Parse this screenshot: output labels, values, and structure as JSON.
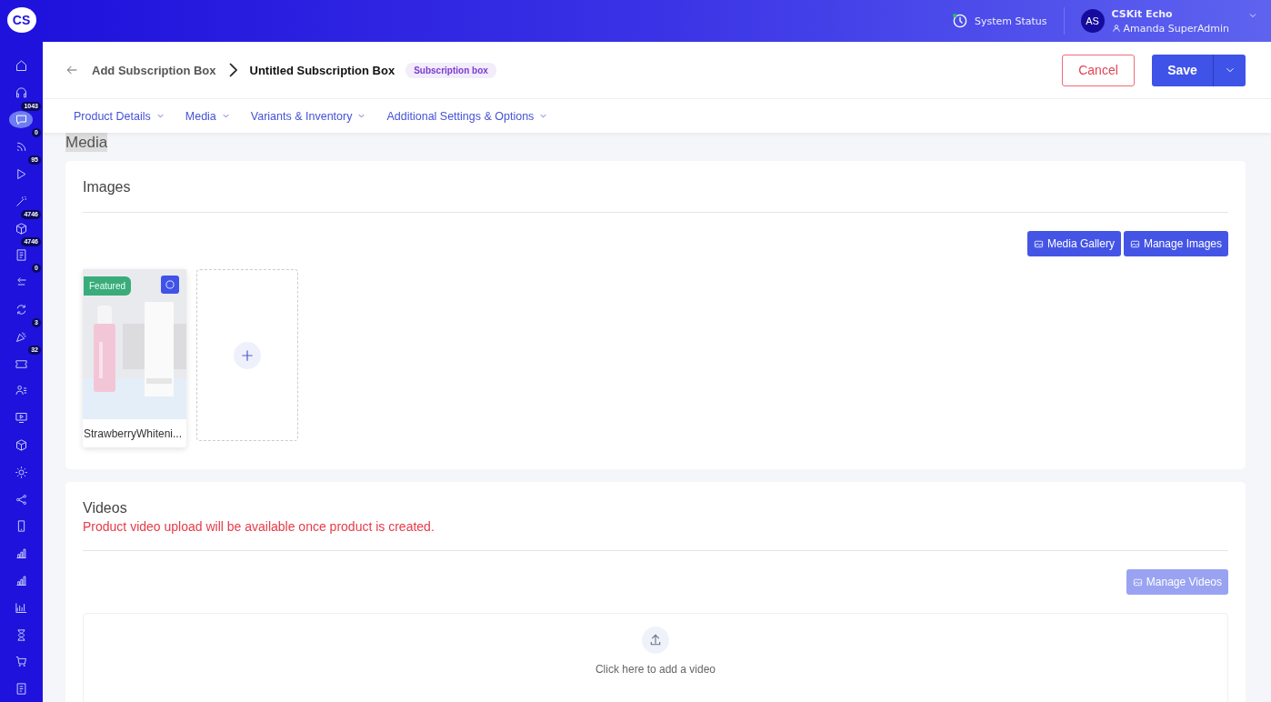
{
  "logo": "CS",
  "sidebar": {
    "items": [
      {
        "selected": false
      },
      {
        "selected": false
      },
      {
        "selected": true,
        "badge": "1043"
      },
      {
        "selected": false,
        "badge": "0"
      },
      {
        "selected": false,
        "badge": "95"
      },
      {
        "selected": false
      },
      {
        "selected": false,
        "badge": "4746"
      },
      {
        "selected": false,
        "badge": "4746"
      },
      {
        "selected": false,
        "badge": "0"
      },
      {
        "selected": false
      },
      {
        "selected": false,
        "badge": "3"
      },
      {
        "selected": false,
        "badge": "32"
      },
      {
        "selected": false
      },
      {
        "selected": false
      },
      {
        "selected": false
      },
      {
        "selected": false
      },
      {
        "selected": false
      },
      {
        "selected": false
      },
      {
        "selected": false
      },
      {
        "selected": false
      },
      {
        "selected": false
      },
      {
        "selected": false
      },
      {
        "selected": false
      },
      {
        "selected": false
      }
    ]
  },
  "topbar": {
    "system_status": "System Status",
    "user": {
      "initials": "AS",
      "org": "CSKit Echo",
      "name": "Amanda SuperAdmin"
    }
  },
  "header": {
    "breadcrumb": "Add Subscription Box",
    "title": "Untitled Subscription Box",
    "tag": "Subscription box",
    "buttons": {
      "cancel": "Cancel",
      "save": "Save"
    }
  },
  "tabs": [
    {
      "label": "Product Details"
    },
    {
      "label": "Media"
    },
    {
      "label": "Variants & Inventory"
    },
    {
      "label": "Additional Settings & Options"
    }
  ],
  "section_title": "Media",
  "images": {
    "title": "Images",
    "buttons": [
      "Media Gallery",
      "Manage Images"
    ],
    "items": [
      {
        "featured": true,
        "badge": "Featured",
        "name": "StrawberryWhiteni..."
      }
    ]
  },
  "videos": {
    "title": "Videos",
    "notice": "Product video upload will be available once product is created.",
    "button": {
      "label": "Manage Videos",
      "disabled": true
    },
    "upload": "Click here to add a video"
  }
}
